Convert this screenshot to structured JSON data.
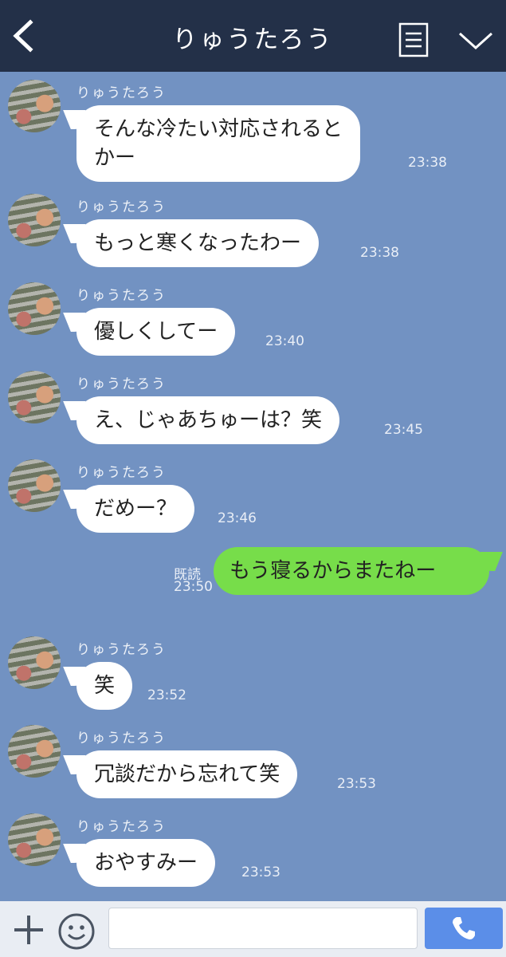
{
  "header": {
    "title": "りゅうたろう",
    "back_icon": "chevron-left-icon",
    "menu_icon": "list-icon",
    "collapse_icon": "chevron-down-icon"
  },
  "messages": [
    {
      "sender": "りゅうたろう",
      "text": "そんな冷たい対応されると\nかー",
      "time": "23:38"
    },
    {
      "sender": "りゅうたろう",
      "text": "もっと寒くなったわー",
      "time": "23:38"
    },
    {
      "sender": "りゅうたろう",
      "text": "優しくしてー",
      "time": "23:40"
    },
    {
      "sender": "りゅうたろう",
      "text": "え、じゃあちゅーは？笑",
      "time": "23:45"
    },
    {
      "sender": "りゅうたろう",
      "text": "だめー？",
      "time": "23:46"
    },
    {
      "sender": "りゅうたろう",
      "text": "笑",
      "time": "23:52"
    },
    {
      "sender": "りゅうたろう",
      "text": "冗談だから忘れて笑",
      "time": "23:53"
    },
    {
      "sender": "りゅうたろう",
      "text": "おやすみー",
      "time": "23:53"
    }
  ],
  "sent_message": {
    "text": "もう寝るからまたねー",
    "read_label": "既読",
    "time": "23:50"
  },
  "footer": {
    "input_value": "",
    "plus_icon": "plus-icon",
    "emoji_icon": "smiley-icon",
    "call_icon": "phone-icon"
  },
  "colors": {
    "header_bg": "#233048",
    "chat_bg": "#7292c2",
    "sent_bubble": "#77dd4a",
    "received_bubble": "#ffffff",
    "call_button": "#5b8ee8"
  }
}
